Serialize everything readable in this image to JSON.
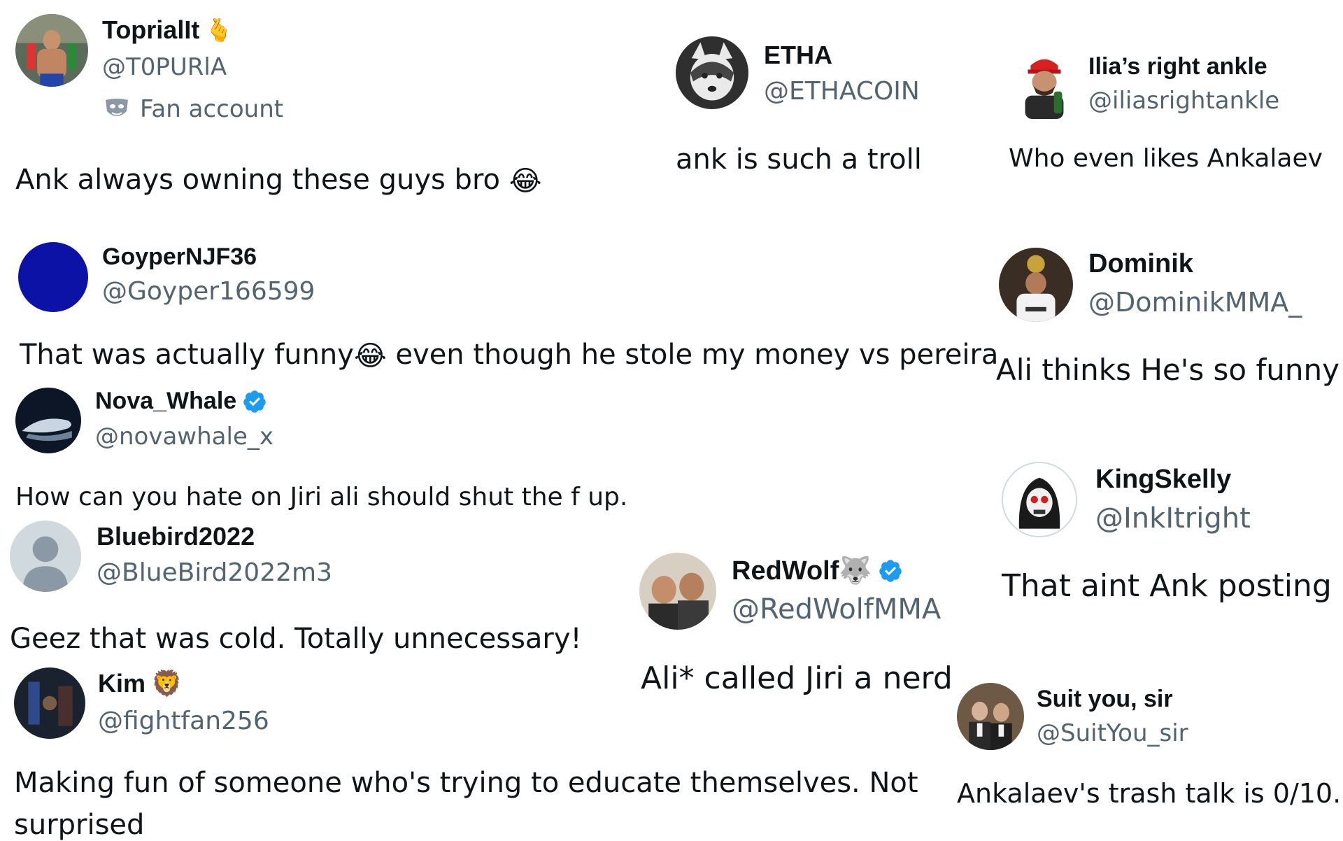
{
  "tweets": [
    {
      "name": "ToprialIt",
      "handle": "@T0PURlA",
      "badge": "Fan account",
      "text": "Ank always owning these guys bro",
      "emoji": "😂"
    },
    {
      "name": "ETHA",
      "handle": "@ETHACOIN",
      "text": "ank is such a troll"
    },
    {
      "name": "Ilia’s right ankle",
      "handle": "@iliasrightankle",
      "text": "Who even likes Ankalaev"
    },
    {
      "name": "GoyperNJF36",
      "handle": "@Goyper166599",
      "text_before": "That was actually funny",
      "emoji": "😂",
      "text_after": " even though he stole my money vs pereira"
    },
    {
      "name": "Dominik",
      "handle": "@DominikMMA_",
      "text": "Ali thinks He's so funny"
    },
    {
      "name": "Nova_Whale",
      "handle": "@novawhale_x",
      "verified": true,
      "text": "How can you hate on Jiri ali should shut the f up."
    },
    {
      "name": "KingSkelly",
      "handle": "@InkItright",
      "text": "That aint Ank posting"
    },
    {
      "name": "Bluebird2022",
      "handle": "@BlueBird2022m3",
      "text": "Geez that was cold. Totally unnecessary!"
    },
    {
      "name": "RedWolf",
      "name_emoji": "🐺",
      "handle": "@RedWolfMMA",
      "verified": true,
      "text": "Ali* called Jiri a nerd"
    },
    {
      "name": "Kim",
      "name_emoji": "🦁",
      "handle": "@fightfan256",
      "text_line1": "Making fun of someone who's trying to educate themselves. Not",
      "text_line2": "surprised"
    },
    {
      "name": "Suit you, sir",
      "handle": "@SuitYou_sir",
      "text": "Ankalaev's trash talk is 0/10."
    }
  ],
  "colors": {
    "name": "#0f1419",
    "handle": "#536471",
    "verified": "#1d9bf0"
  }
}
